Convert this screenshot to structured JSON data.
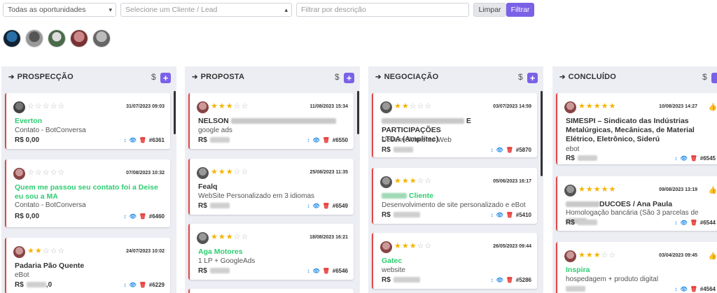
{
  "filters": {
    "opportunity_select": "Todas as oportunidades",
    "client_select_placeholder": "Selecione um Cliente / Lead",
    "description_placeholder": "Filtrar por descrição",
    "clear_label": "Limpar",
    "filter_label": "Filtrar"
  },
  "columns": [
    {
      "title": "PROSPECÇÃO",
      "dollar": "$",
      "add": "+",
      "cards": [
        {
          "stars": 0,
          "date": "31/07/2023 09:03",
          "title": "Everton",
          "subtitle": "Contato - BotConversa",
          "value": "R$ 0,00",
          "id": "#6361"
        },
        {
          "stars": 0,
          "date": "07/08/2023 10:32",
          "title": "Quem me passou seu contato foi a Deise eu sou a MA",
          "subtitle": "Contato - BotConversa",
          "value": "R$ 0,00",
          "id": "#6460"
        },
        {
          "stars": 2,
          "date": "24/07/2023 10:02",
          "title": "Padaria Pão Quente",
          "subtitle": "eBot",
          "value": "R$",
          "value_suffix": ",0",
          "id": "#6229"
        }
      ]
    },
    {
      "title": "PROPOSTA",
      "dollar": "$",
      "add": "+",
      "cards": [
        {
          "stars": 3,
          "date": "11/08/2023 15:34",
          "title": "NELSON",
          "subtitle": "google ads",
          "value": "R$",
          "id": "#6550"
        },
        {
          "stars": 3,
          "date": "25/08/2023 11:35",
          "title": "Fealq",
          "subtitle": "WebSite Personalizado em 3 idiomas",
          "value": "R$",
          "id": "#6549"
        },
        {
          "stars": 3,
          "date": "18/08/2023 16:21",
          "title": "Aga Motores",
          "subtitle": "1 LP + GoogleAds",
          "value": "R$",
          "id": "#6546"
        }
      ]
    },
    {
      "title": "NEGOCIAÇÃO",
      "dollar": "$",
      "add": "+",
      "cards": [
        {
          "stars": 2,
          "date": "03/07/2023 14:59",
          "title_line1": "E PARTICIPAÇÕES",
          "title_line2": "LTDA (Amplitec)",
          "subtitle": "Desenvolvimento Web",
          "value": "R$",
          "id": "#5870"
        },
        {
          "stars": 3,
          "date": "05/06/2023 16:17",
          "title": "Cliente",
          "subtitle": "Desenvolvimento de site personalizado e eBot",
          "value": "R$",
          "id": "#5410"
        },
        {
          "stars": 3,
          "date": "26/05/2023 09:44",
          "title": "Gatec",
          "subtitle": "website",
          "value": "R$",
          "id": "#5286"
        }
      ]
    },
    {
      "title": "CONCLUÍDO",
      "dollar": "$",
      "cards": [
        {
          "stars": 5,
          "date": "10/08/2023 14:27",
          "title": "SIMESPI – Sindicato das Indústrias Metalúrgicas, Mecânicas, de Material Elétrico, Eletrônico, Siderú",
          "subtitle": "ebot",
          "value": "R$",
          "id": "#6545"
        },
        {
          "stars": 5,
          "date": "09/08/2023 13:19",
          "title": "DUCOES / Ana Paula",
          "subtitle": "Homologação bancária (São 3 parcelas de",
          "value": "R$",
          "id": "#6544"
        },
        {
          "stars": 3,
          "date": "03/04/2023 09:45",
          "title": "Inspira",
          "subtitle": "hospedagem + produto digital",
          "value": "",
          "id": "#4564"
        }
      ]
    }
  ],
  "icons": {
    "move": "↕",
    "view": "👁",
    "delete": "🗑",
    "like": "👍"
  },
  "colors": {
    "accent": "#7b61e6",
    "green": "#2ecc71",
    "card_border": "#e04848",
    "star": "#f5b400"
  }
}
